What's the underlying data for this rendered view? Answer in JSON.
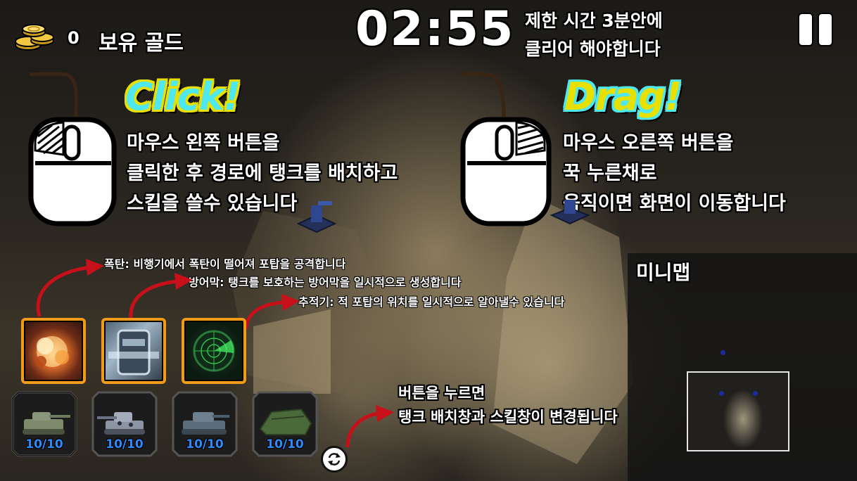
{
  "hud": {
    "gold_count": "0",
    "gold_label": "보유 골드",
    "timer": "02:55",
    "time_limit_line1": "제한 시간 3분안에",
    "time_limit_line2": "클리어 해야합니다",
    "pause_icon": "pause-icon"
  },
  "tutorial": {
    "click_heading": "Click!",
    "click_line1": "마우스 왼쪽 버튼을",
    "click_line2": "클릭한 후 경로에 탱크를 배치하고",
    "click_line3": "스킬을 쓸수 있습니다",
    "drag_heading": "Drag!",
    "drag_line1": "마우스 오른쪽 버튼을",
    "drag_line2": "꾹 누른채로",
    "drag_line3": "움직이면 화면이 이동합니다"
  },
  "skills": {
    "bomb_desc": "폭탄: 비행기에서 폭탄이 떨어져 포탑을 공격합니다",
    "shield_desc": "방어막: 탱크를 보호하는 방어막을 일시적으로 생성합니다",
    "tracker_desc": "추적기: 적 포탑의 위치를 일시적으로 알아낼수 있습니다",
    "items": [
      {
        "icon": "bomb-icon"
      },
      {
        "icon": "shield-icon"
      },
      {
        "icon": "radar-icon"
      }
    ]
  },
  "tanks": [
    {
      "count": "10/10",
      "icon": "tank-icon"
    },
    {
      "count": "10/10",
      "icon": "tank-icon"
    },
    {
      "count": "10/10",
      "icon": "tank-icon"
    },
    {
      "count": "10/10",
      "icon": "tank-icon"
    }
  ],
  "swap": {
    "line1": "버튼을 누르면",
    "line2": "탱크 배치창과 스킬창이 변경됩니다",
    "icon": "swap-icon"
  },
  "minimap": {
    "title": "미니맵"
  },
  "colors": {
    "skill_border": "#f29a1a",
    "tank_count": "#2a8bff",
    "arrow": "#c8101a",
    "click_heading": "#4fe8f0",
    "drag_heading": "#e8e000"
  }
}
